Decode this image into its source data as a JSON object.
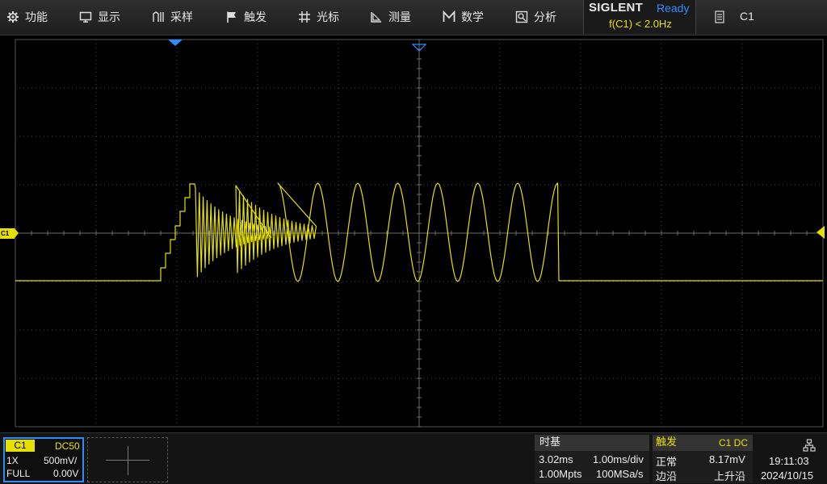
{
  "menu": {
    "items": [
      {
        "id": "function",
        "label": "功能",
        "icon": "gear-icon"
      },
      {
        "id": "display",
        "label": "显示",
        "icon": "monitor-icon"
      },
      {
        "id": "acquire",
        "label": "采样",
        "icon": "acquire-icon"
      },
      {
        "id": "trigger",
        "label": "触发",
        "icon": "flag-icon"
      },
      {
        "id": "cursors",
        "label": "光标",
        "icon": "cursor-grid-icon"
      },
      {
        "id": "measure",
        "label": "测量",
        "icon": "measure-icon"
      },
      {
        "id": "math",
        "label": "数学",
        "icon": "math-icon"
      },
      {
        "id": "analysis",
        "label": "分析",
        "icon": "analysis-icon"
      }
    ]
  },
  "brand": {
    "name": "SIGLENT",
    "run_state": "Ready",
    "frequency_readout": "f(C1) < 2.0Hz"
  },
  "channel_menu": {
    "icon": "document-icon",
    "label": "C1"
  },
  "screen": {
    "channel_marker": "C1",
    "trace_color": "#e6e000",
    "accent_color": "#2f8cff",
    "grid_divisions": {
      "horizontal": 10,
      "vertical": 8
    }
  },
  "channel1": {
    "tag": "C1",
    "coupling": "DC50",
    "probe": "1X",
    "scale": "500mV/",
    "bandwidth": "FULL",
    "offset": "0.00V"
  },
  "timebase": {
    "title": "时基",
    "delay": "3.02ms",
    "scale": "1.00ms/div",
    "memory_depth": "1.00Mpts",
    "sample_rate": "100MSa/s"
  },
  "trigger": {
    "title": "触发",
    "source": "C1 DC",
    "mode": "正常",
    "level": "8.17mV",
    "type": "边沿",
    "slope": "上升沿"
  },
  "clock": {
    "time": "19:11:03",
    "date": "2024/10/15",
    "icon": "network-icon"
  }
}
